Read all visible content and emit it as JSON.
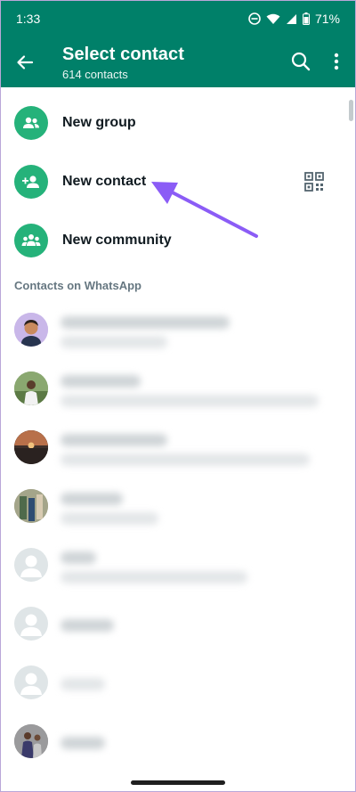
{
  "status": {
    "time": "1:33",
    "battery": "71%",
    "icons": [
      "do-not-disturb-icon",
      "wifi-icon",
      "signal-icon",
      "battery-icon"
    ]
  },
  "appbar": {
    "title": "Select contact",
    "subtitle": "614 contacts",
    "icons": [
      "back-arrow-icon",
      "search-icon",
      "more-vert-icon"
    ]
  },
  "actions": [
    {
      "label": "New group",
      "icon": "group-icon"
    },
    {
      "label": "New contact",
      "icon": "add-person-icon",
      "trailing_icon": "qr-code-icon"
    },
    {
      "label": "New community",
      "icon": "community-icon"
    }
  ],
  "section": {
    "label": "Contacts on WhatsApp"
  },
  "contacts": [
    {
      "avatar": "cartoon-avatar"
    },
    {
      "avatar": "photo-avatar"
    },
    {
      "avatar": "photo-avatar"
    },
    {
      "avatar": "photo-avatar"
    },
    {
      "avatar": "default-avatar"
    },
    {
      "avatar": "default-avatar"
    },
    {
      "avatar": "default-avatar"
    },
    {
      "avatar": "photo-avatar"
    }
  ],
  "colors": {
    "header": "#008069",
    "action_icon": "#25b27a",
    "annotation_arrow": "#8b5cf6"
  }
}
